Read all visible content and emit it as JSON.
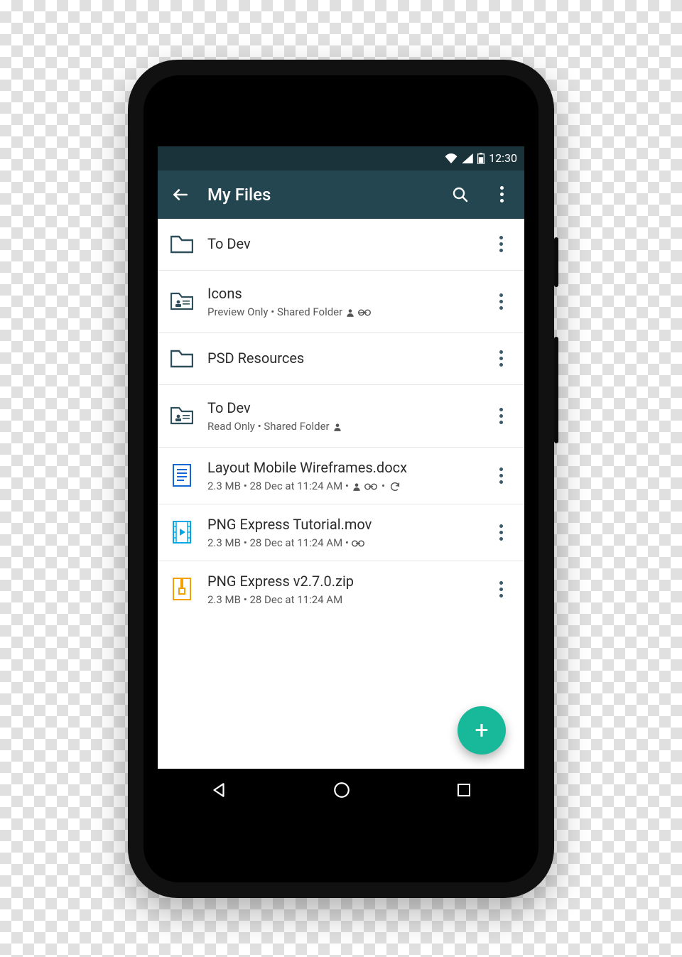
{
  "statusbar": {
    "time": "12:30"
  },
  "appbar": {
    "title": "My Files"
  },
  "fab": {
    "label": "+"
  },
  "items": [
    {
      "name": "To Dev",
      "meta": null,
      "icon": "folder",
      "badges": []
    },
    {
      "name": "Icons",
      "meta": "Preview Only • Shared Folder",
      "icon": "shared-folder",
      "badges": [
        "person",
        "link"
      ]
    },
    {
      "name": "PSD Resources",
      "meta": null,
      "icon": "folder",
      "badges": []
    },
    {
      "name": "To Dev",
      "meta": "Read Only • Shared Folder",
      "icon": "shared-folder",
      "badges": [
        "person"
      ]
    },
    {
      "name": "Layout Mobile Wireframes.docx",
      "meta": "2.3 MB • 28 Dec at 11:24 AM •",
      "icon": "doc",
      "badges": [
        "person",
        "link",
        "sync"
      ]
    },
    {
      "name": "PNG Express Tutorial.mov",
      "meta": "2.3 MB • 28 Dec at 11:24 AM •",
      "icon": "video",
      "badges": [
        "link"
      ]
    },
    {
      "name": "PNG Express v2.7.0.zip",
      "meta": "2.3 MB • 28 Dec at 11:24 AM",
      "icon": "zip",
      "badges": []
    }
  ]
}
